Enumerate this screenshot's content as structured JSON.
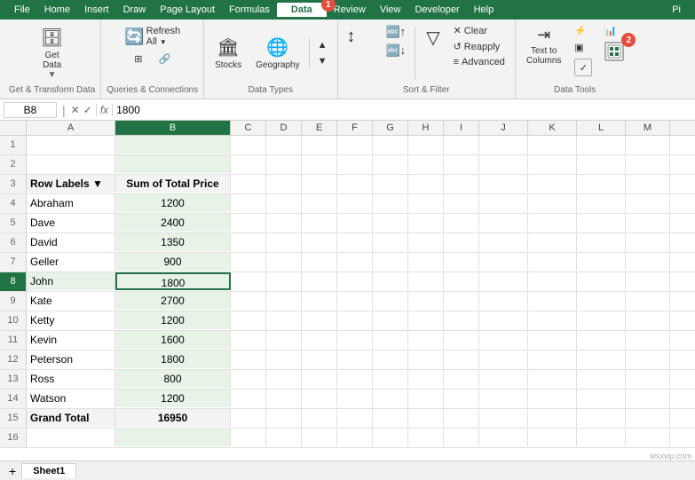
{
  "menubar": {
    "items": [
      "File",
      "Home",
      "Insert",
      "Draw",
      "Page Layout",
      "Formulas",
      "Data",
      "Review",
      "View",
      "Developer",
      "Help"
    ],
    "active": "Data"
  },
  "ribbon": {
    "groups": [
      {
        "id": "get-transform",
        "label": "Get & Transform Data",
        "buttons": [
          {
            "label": "Get\nData",
            "icon": "🗄"
          }
        ]
      },
      {
        "id": "queries",
        "label": "Queries & Connections",
        "buttons": [
          {
            "label": "Refresh\nAll",
            "icon": "🔄"
          },
          {
            "label": "",
            "icon": "🔗"
          }
        ]
      },
      {
        "id": "data-types",
        "label": "Data Types",
        "buttons": [
          {
            "label": "Stocks",
            "icon": "🏛"
          },
          {
            "label": "Geography",
            "icon": "🌐"
          }
        ]
      },
      {
        "id": "sort-filter",
        "label": "Sort & Filter",
        "buttons": [
          {
            "label": "Sort",
            "icon": "↕"
          },
          {
            "label": "Filter",
            "icon": "▽"
          },
          {
            "label": "Clear",
            "icon": "✕"
          },
          {
            "label": "Reapply",
            "icon": "↺"
          },
          {
            "label": "Advanced",
            "icon": "≡"
          }
        ]
      },
      {
        "id": "data-tools",
        "label": "Data Tools",
        "buttons": [
          {
            "label": "Text to\nColumns",
            "icon": "⇥"
          },
          {
            "label": "",
            "icon": "▤"
          }
        ]
      }
    ]
  },
  "formula_bar": {
    "cell_ref": "B8",
    "formula": "1800"
  },
  "sheet": {
    "col_headers": [
      "A",
      "B",
      "C",
      "D",
      "E",
      "F",
      "G",
      "H",
      "I",
      "J",
      "K",
      "L",
      "M"
    ],
    "rows": [
      {
        "num": 1,
        "cells": [
          "",
          "",
          "",
          "",
          "",
          "",
          "",
          "",
          "",
          "",
          "",
          "",
          ""
        ]
      },
      {
        "num": 2,
        "cells": [
          "",
          "",
          "",
          "",
          "",
          "",
          "",
          "",
          "",
          "",
          "",
          "",
          ""
        ]
      },
      {
        "num": 3,
        "cells": [
          "Row Labels ▼",
          "Sum of Total Price",
          "",
          "",
          "",
          "",
          "",
          "",
          "",
          "",
          "",
          "",
          ""
        ],
        "type": "header"
      },
      {
        "num": 4,
        "cells": [
          "Abraham",
          "1200",
          "",
          "",
          "",
          "",
          "",
          "",
          "",
          "",
          "",
          "",
          ""
        ]
      },
      {
        "num": 5,
        "cells": [
          "Dave",
          "2400",
          "",
          "",
          "",
          "",
          "",
          "",
          "",
          "",
          "",
          "",
          ""
        ]
      },
      {
        "num": 6,
        "cells": [
          "David",
          "1350",
          "",
          "",
          "",
          "",
          "",
          "",
          "",
          "",
          "",
          "",
          ""
        ]
      },
      {
        "num": 7,
        "cells": [
          "Geller",
          "900",
          "",
          "",
          "",
          "",
          "",
          "",
          "",
          "",
          "",
          "",
          ""
        ]
      },
      {
        "num": 8,
        "cells": [
          "John",
          "1800",
          "",
          "",
          "",
          "",
          "",
          "",
          "",
          "",
          "",
          "",
          ""
        ],
        "selected": true
      },
      {
        "num": 9,
        "cells": [
          "Kate",
          "2700",
          "",
          "",
          "",
          "",
          "",
          "",
          "",
          "",
          "",
          "",
          ""
        ]
      },
      {
        "num": 10,
        "cells": [
          "Ketty",
          "1200",
          "",
          "",
          "",
          "",
          "",
          "",
          "",
          "",
          "",
          "",
          ""
        ]
      },
      {
        "num": 11,
        "cells": [
          "Kevin",
          "1600",
          "",
          "",
          "",
          "",
          "",
          "",
          "",
          "",
          "",
          "",
          ""
        ]
      },
      {
        "num": 12,
        "cells": [
          "Peterson",
          "1800",
          "",
          "",
          "",
          "",
          "",
          "",
          "",
          "",
          "",
          "",
          ""
        ]
      },
      {
        "num": 13,
        "cells": [
          "Ross",
          "800",
          "",
          "",
          "",
          "",
          "",
          "",
          "",
          "",
          "",
          "",
          ""
        ]
      },
      {
        "num": 14,
        "cells": [
          "Watson",
          "1200",
          "",
          "",
          "",
          "",
          "",
          "",
          "",
          "",
          "",
          "",
          ""
        ]
      },
      {
        "num": 15,
        "cells": [
          "Grand Total",
          "16950",
          "",
          "",
          "",
          "",
          "",
          "",
          "",
          "",
          "",
          "",
          ""
        ],
        "type": "grand-total"
      },
      {
        "num": 16,
        "cells": [
          "",
          "",
          "",
          "",
          "",
          "",
          "",
          "",
          "",
          "",
          "",
          "",
          ""
        ]
      }
    ]
  },
  "sheet_tab": "Sheet1",
  "badges": {
    "data_tab": "1",
    "data_tools": "2"
  }
}
